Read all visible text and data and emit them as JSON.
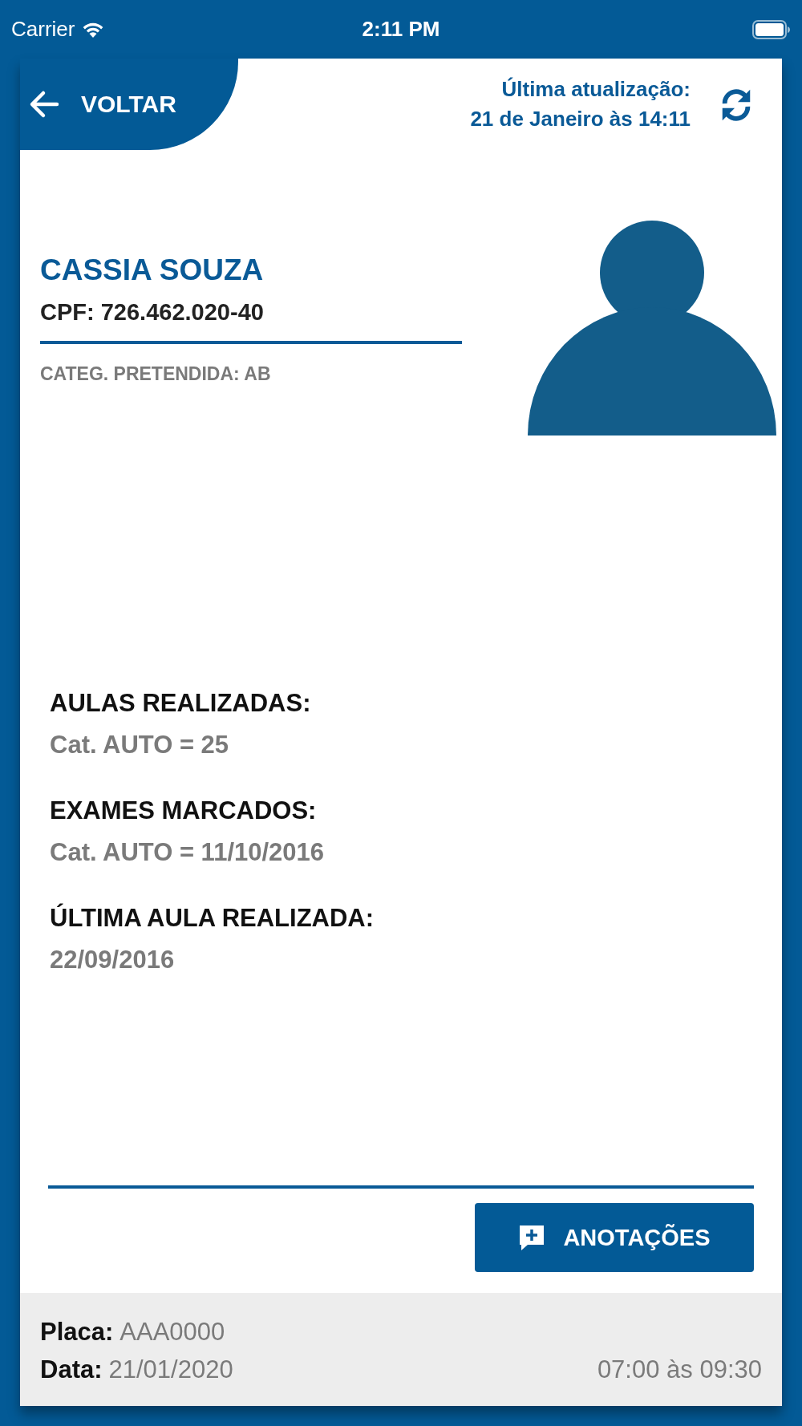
{
  "status_bar": {
    "carrier": "Carrier",
    "time": "2:11 PM"
  },
  "header": {
    "back": "VOLTAR",
    "update_label": "Última atualização:",
    "update_time": "21 de Janeiro às 14:11"
  },
  "student": {
    "name": "CASSIA SOUZA",
    "cpf": "CPF: 726.462.020-40",
    "category": "CATEG. PRETENDIDA: AB"
  },
  "sections": [
    {
      "heading": "AULAS REALIZADAS:",
      "value": "Cat. AUTO = 25"
    },
    {
      "heading": "EXAMES MARCADOS:",
      "value": "Cat. AUTO = 11/10/2016"
    },
    {
      "heading": "ÚLTIMA AULA REALIZADA:",
      "value": "22/09/2016"
    }
  ],
  "notes_button": "ANOTAÇÕES",
  "footer": {
    "plate_label": "Placa:",
    "plate": "AAA0000",
    "date_label": "Data:",
    "date": "21/01/2020",
    "time": "07:00 às 09:30"
  }
}
